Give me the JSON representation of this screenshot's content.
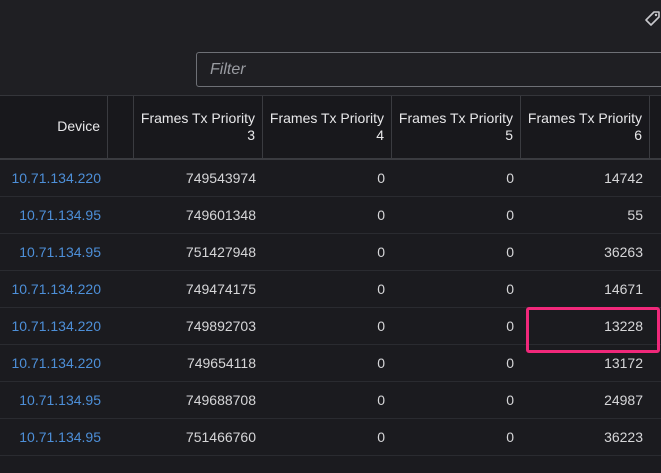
{
  "filter": {
    "placeholder": "Filter"
  },
  "icons": {
    "tag": "tag-icon"
  },
  "colors": {
    "background": "#1f1f23",
    "link": "#4d8fd8",
    "text": "#d6d6d8",
    "highlight": "#f0287a"
  },
  "table": {
    "headers": [
      {
        "line1": "Device",
        "line2": ""
      },
      {
        "line1": "",
        "line2": ""
      },
      {
        "line1": "Frames Tx Priority",
        "line2": "3"
      },
      {
        "line1": "Frames Tx Priority",
        "line2": "4"
      },
      {
        "line1": "Frames Tx Priority",
        "line2": "5"
      },
      {
        "line1": "Frames Tx Priority",
        "line2": "6"
      }
    ],
    "rows": [
      {
        "device": "10.71.134.220",
        "p3": "749543974",
        "p4": "0",
        "p5": "0",
        "p6": "14742"
      },
      {
        "device": "10.71.134.95",
        "p3": "749601348",
        "p4": "0",
        "p5": "0",
        "p6": "55"
      },
      {
        "device": "10.71.134.95",
        "p3": "751427948",
        "p4": "0",
        "p5": "0",
        "p6": "36263"
      },
      {
        "device": "10.71.134.220",
        "p3": "749474175",
        "p4": "0",
        "p5": "0",
        "p6": "14671"
      },
      {
        "device": "10.71.134.220",
        "p3": "749892703",
        "p4": "0",
        "p5": "0",
        "p6": "13228"
      },
      {
        "device": "10.71.134.220",
        "p3": "749654118",
        "p4": "0",
        "p5": "0",
        "p6": "13172"
      },
      {
        "device": "10.71.134.95",
        "p3": "749688708",
        "p4": "0",
        "p5": "0",
        "p6": "24987"
      },
      {
        "device": "10.71.134.95",
        "p3": "751466760",
        "p4": "0",
        "p5": "0",
        "p6": "36223"
      }
    ],
    "highlighted_cell": {
      "row": 4,
      "column": "p6"
    }
  }
}
